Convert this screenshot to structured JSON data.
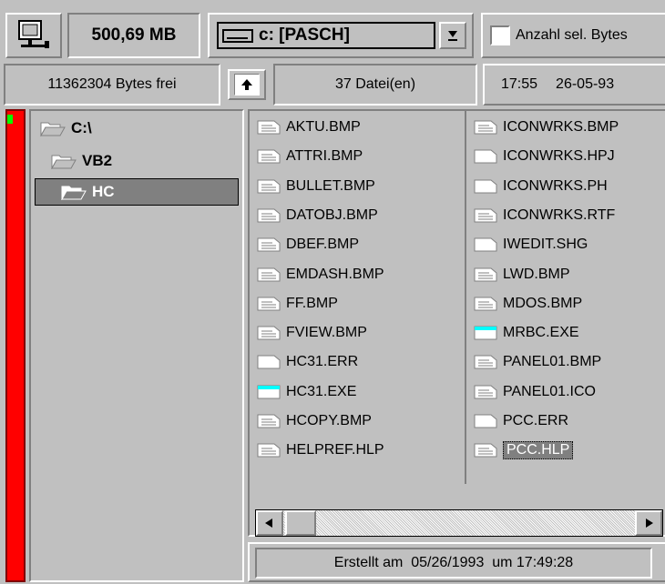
{
  "toolbar": {
    "network_button_icon": "network-drive-icon",
    "disk_size": "500,69 MB",
    "drive_selected": "c: [PASCH]",
    "checkbox_label": "Anzahl sel. Bytes",
    "checkbox_checked": false
  },
  "info": {
    "free_bytes": "11362304 Bytes frei",
    "file_count": "37 Datei(en)",
    "time": "17:55",
    "date": "26-05-93"
  },
  "tree": {
    "items": [
      {
        "label": "C:\\",
        "level": 0,
        "open": true
      },
      {
        "label": "VB2",
        "level": 1,
        "open": true
      },
      {
        "label": "HC",
        "level": 2,
        "open": true,
        "selected": true
      }
    ]
  },
  "files": {
    "column1": [
      {
        "name": "AKTU.BMP",
        "icon": "document-icon"
      },
      {
        "name": "ATTRI.BMP",
        "icon": "document-icon"
      },
      {
        "name": "BULLET.BMP",
        "icon": "document-icon"
      },
      {
        "name": "DATOBJ.BMP",
        "icon": "document-icon"
      },
      {
        "name": "DBEF.BMP",
        "icon": "document-icon"
      },
      {
        "name": "EMDASH.BMP",
        "icon": "document-icon"
      },
      {
        "name": "FF.BMP",
        "icon": "document-icon"
      },
      {
        "name": "FVIEW.BMP",
        "icon": "document-icon"
      },
      {
        "name": "HC31.ERR",
        "icon": "blank-file-icon"
      },
      {
        "name": "HC31.EXE",
        "icon": "program-icon"
      },
      {
        "name": "HCOPY.BMP",
        "icon": "document-icon"
      },
      {
        "name": "HELPREF.HLP",
        "icon": "document-icon"
      }
    ],
    "column2": [
      {
        "name": "ICONWRKS.BMP",
        "icon": "document-icon"
      },
      {
        "name": "ICONWRKS.HPJ",
        "icon": "blank-file-icon"
      },
      {
        "name": "ICONWRKS.PH",
        "icon": "blank-file-icon"
      },
      {
        "name": "ICONWRKS.RTF",
        "icon": "document-icon"
      },
      {
        "name": "IWEDIT.SHG",
        "icon": "blank-file-icon"
      },
      {
        "name": "LWD.BMP",
        "icon": "document-icon"
      },
      {
        "name": "MDOS.BMP",
        "icon": "document-icon"
      },
      {
        "name": "MRBC.EXE",
        "icon": "program-icon"
      },
      {
        "name": "PANEL01.BMP",
        "icon": "document-icon"
      },
      {
        "name": "PANEL01.ICO",
        "icon": "document-icon"
      },
      {
        "name": "PCC.ERR",
        "icon": "blank-file-icon"
      },
      {
        "name": "PCC.HLP",
        "icon": "document-icon",
        "selected": true
      }
    ]
  },
  "status": {
    "text": "Erstellt am  05/26/1993  um 17:49:28"
  },
  "colors": {
    "face": "#c0c0c0",
    "shadow": "#808080",
    "strip": "#ff0000",
    "led": "#00ff00",
    "program_bar": "#00ffff"
  }
}
